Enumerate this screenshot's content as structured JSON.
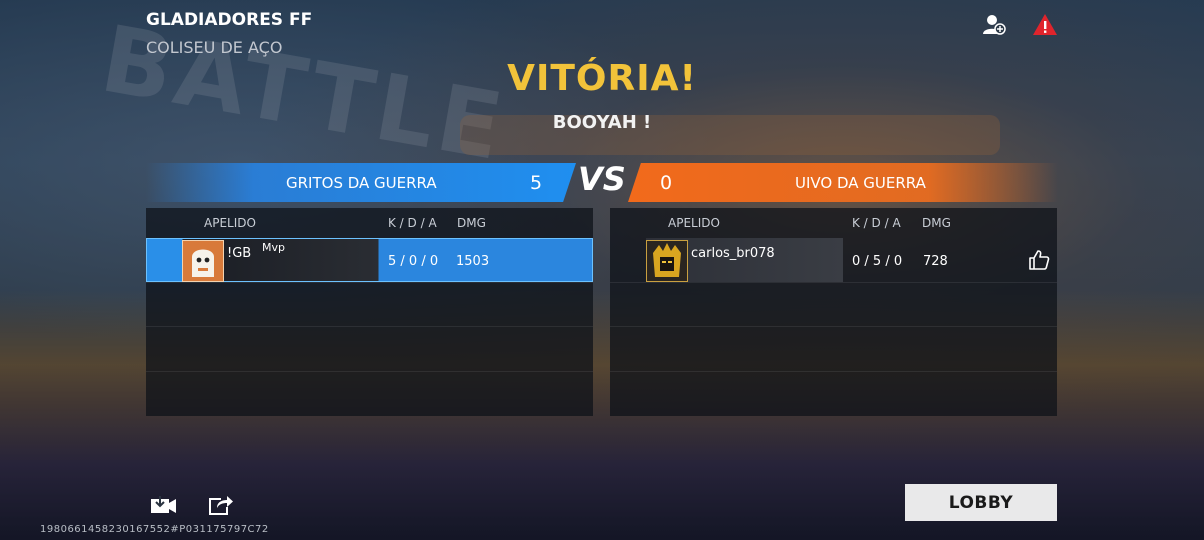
{
  "header": {
    "room_title": "GLADIADORES FF",
    "room_subtitle": "COLISEU DE AÇO"
  },
  "result": {
    "headline": "VITÓRIA!",
    "subline": "BOOYAH !"
  },
  "vs_label": "VS",
  "teams": [
    {
      "name": "GRITOS DA GUERRA",
      "score": "5",
      "color": "#1f8ff0"
    },
    {
      "name": "UIVO DA GUERRA",
      "score": "0",
      "color": "#f26a1b"
    }
  ],
  "columns": {
    "name": "APELIDO",
    "kda": "K / D / A",
    "dmg": "DMG"
  },
  "players": {
    "left": [
      {
        "name": "!GB",
        "tag": "Mvp",
        "kda": "5 / 0 / 0",
        "dmg": "1503"
      }
    ],
    "right": [
      {
        "name": "carlos_br078",
        "kda": "0 / 5 / 0",
        "dmg": "728"
      }
    ]
  },
  "icons": {
    "top_right": [
      "add-friend-icon",
      "report-warning-icon"
    ],
    "bottom_left": [
      "save-replay-icon",
      "share-icon"
    ],
    "like": "thumbs-up-icon"
  },
  "footer": {
    "lobby_label": "LOBBY",
    "match_id": "1980661458230167552#P031175797C72"
  },
  "colors": {
    "headline": "#f2c33a",
    "accent_blue": "#2a8fe8",
    "accent_orange": "#f26a1b",
    "warning": "#e0242c"
  }
}
